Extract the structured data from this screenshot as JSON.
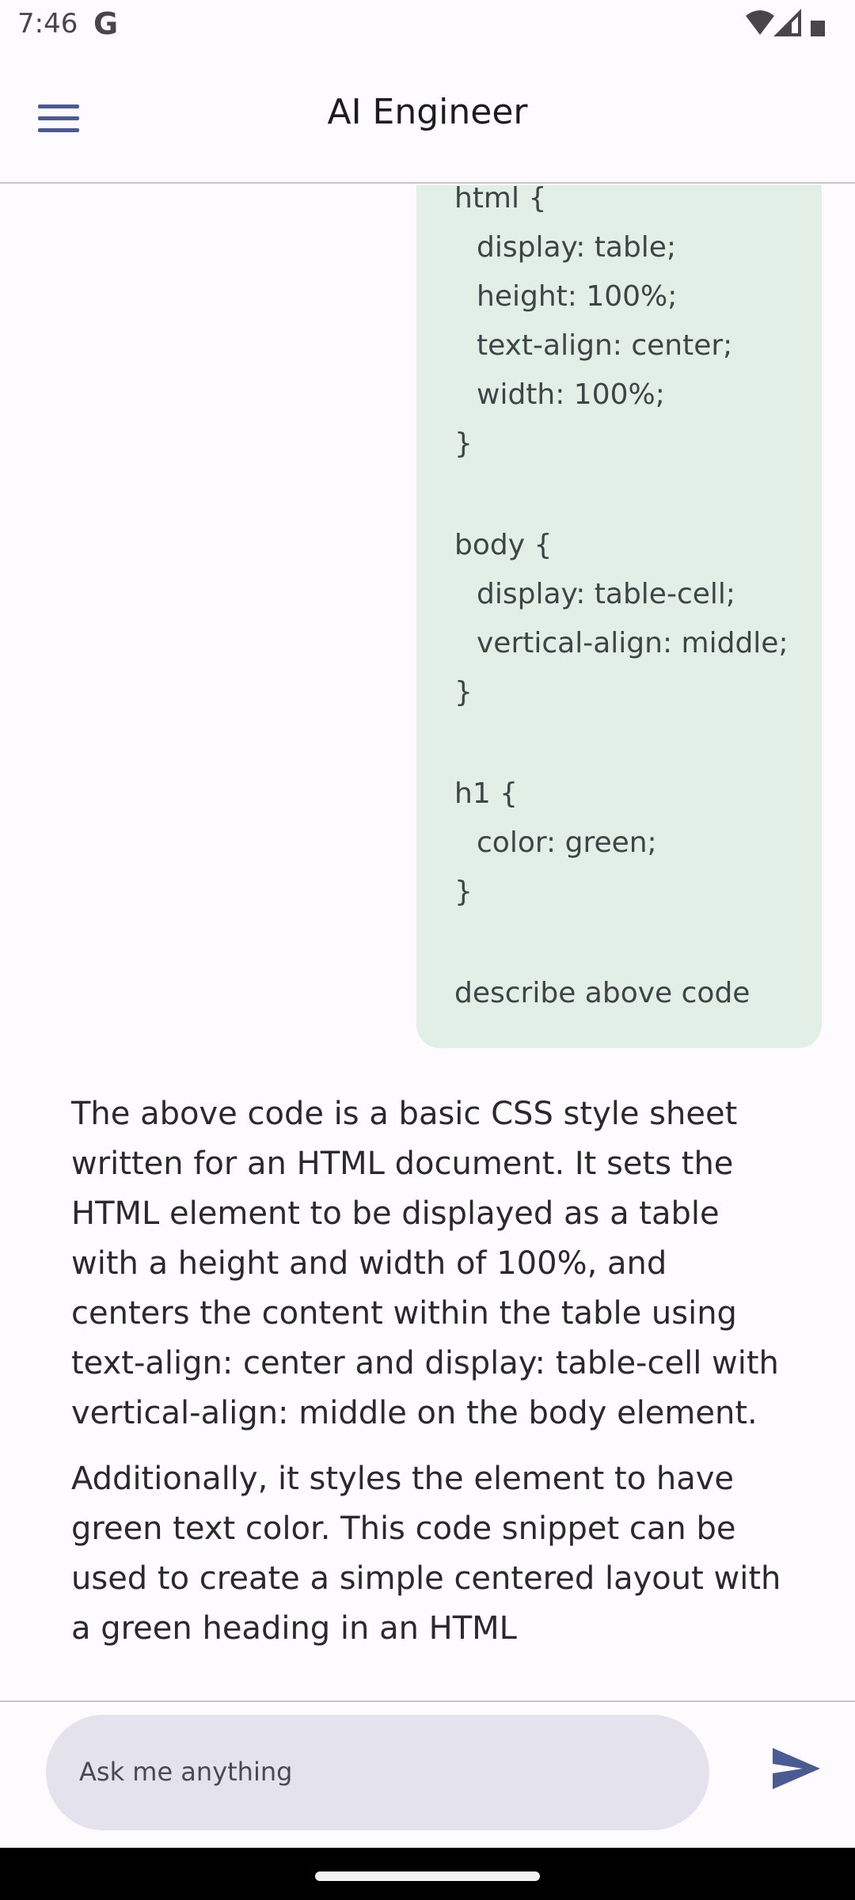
{
  "status_bar": {
    "time": "7:46",
    "google_badge": "G"
  },
  "app_bar": {
    "title": "AI Engineer"
  },
  "chat": {
    "user_message": {
      "lines": [
        {
          "text": "html {",
          "indent": false
        },
        {
          "text": "display: table;",
          "indent": true
        },
        {
          "text": "height: 100%;",
          "indent": true
        },
        {
          "text": "text-align: center;",
          "indent": true
        },
        {
          "text": "width: 100%;",
          "indent": true
        },
        {
          "text": "}",
          "indent": false
        },
        {
          "text": "body {",
          "indent": false
        },
        {
          "text": "display: table-cell;",
          "indent": true
        },
        {
          "text": "vertical-align: middle;",
          "indent": true
        },
        {
          "text": "}",
          "indent": false
        },
        {
          "text": "h1 {",
          "indent": false
        },
        {
          "text": "color: green;",
          "indent": true
        },
        {
          "text": "}",
          "indent": false
        },
        {
          "text": "describe above code",
          "indent": false
        }
      ]
    },
    "assistant_message": {
      "paragraphs": [
        "The above code is a basic CSS style sheet written for an HTML document. It sets the HTML element to be displayed as a table with a height and width of 100%, and centers the content within the table using text-align: center and display: table-cell with vertical-align: middle on the body element.",
        "Additionally, it styles the  element to have green text color. This code snippet can be used to create a simple centered layout with a green heading in an HTML"
      ]
    }
  },
  "input": {
    "placeholder": "Ask me anything",
    "value": ""
  },
  "colors": {
    "user_bubble_bg": "#e1efe7",
    "accent": "#4a5a92",
    "input_bg": "#e4e2ec"
  }
}
